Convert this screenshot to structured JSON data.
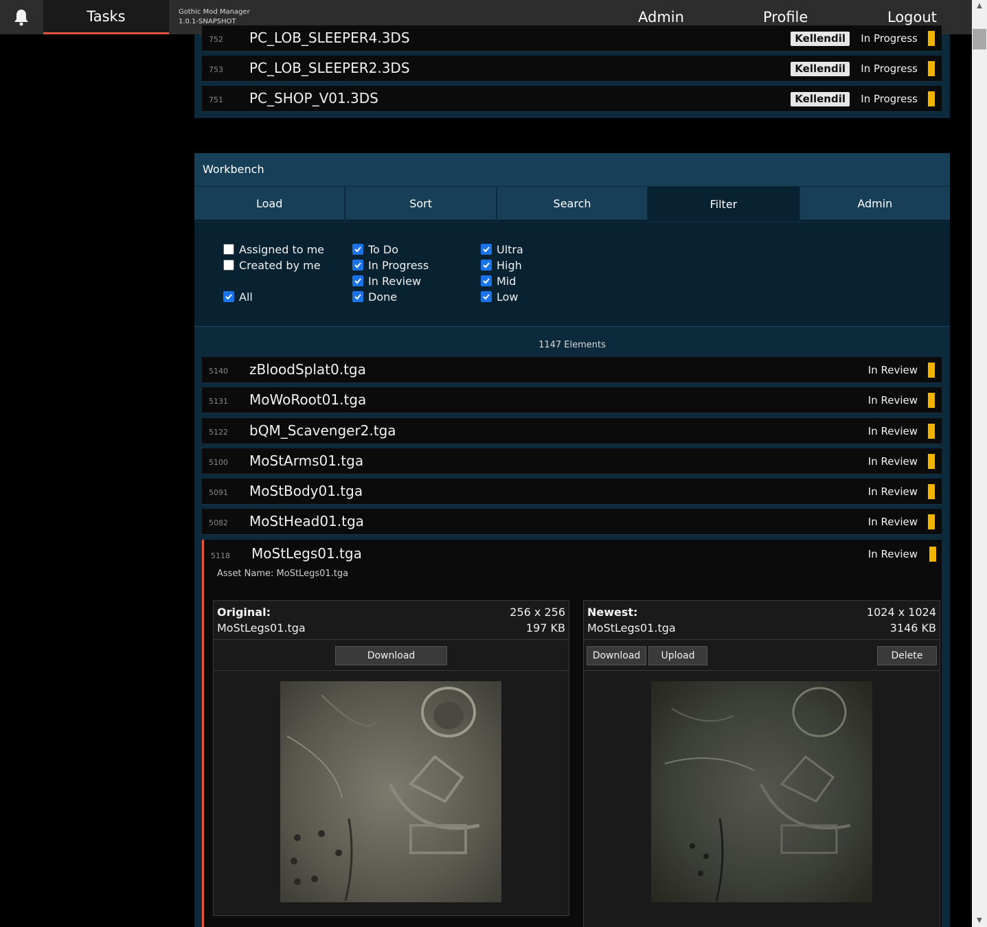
{
  "topbar": {
    "tasks": "Tasks",
    "app_name": "Gothic Mod Manager",
    "app_version": "1.0.1-SNAPSHOT",
    "admin": "Admin",
    "profile": "Profile",
    "logout": "Logout"
  },
  "top_rows": [
    {
      "id": "752",
      "name": "PC_LOB_SLEEPER4.3DS",
      "user": "Kellendil",
      "status": "In Progress"
    },
    {
      "id": "753",
      "name": "PC_LOB_SLEEPER2.3DS",
      "user": "Kellendil",
      "status": "In Progress"
    },
    {
      "id": "751",
      "name": "PC_SHOP_V01.3DS",
      "user": "Kellendil",
      "status": "In Progress"
    }
  ],
  "workbench": {
    "title": "Workbench",
    "tabs": [
      "Load",
      "Sort",
      "Search",
      "Filter",
      "Admin"
    ],
    "active_tab": "Filter",
    "filters": {
      "assigned_to_me": {
        "label": "Assigned to me",
        "checked": false
      },
      "created_by_me": {
        "label": "Created by me",
        "checked": false
      },
      "all": {
        "label": "All",
        "checked": true
      },
      "status": [
        {
          "label": "To Do",
          "checked": true
        },
        {
          "label": "In Progress",
          "checked": true
        },
        {
          "label": "In Review",
          "checked": true
        },
        {
          "label": "Done",
          "checked": true
        }
      ],
      "priority": [
        {
          "label": "Ultra",
          "checked": true
        },
        {
          "label": "High",
          "checked": true
        },
        {
          "label": "Mid",
          "checked": true
        },
        {
          "label": "Low",
          "checked": true
        }
      ]
    },
    "count": "1147 Elements"
  },
  "rows": [
    {
      "id": "5140",
      "name": "zBloodSplat0.tga",
      "status": "In Review"
    },
    {
      "id": "5131",
      "name": "MoWoRoot01.tga",
      "status": "In Review"
    },
    {
      "id": "5122",
      "name": "bQM_Scavenger2.tga",
      "status": "In Review"
    },
    {
      "id": "5100",
      "name": "MoStArms01.tga",
      "status": "In Review"
    },
    {
      "id": "5091",
      "name": "MoStBody01.tga",
      "status": "In Review"
    },
    {
      "id": "5082",
      "name": "MoStHead01.tga",
      "status": "In Review"
    }
  ],
  "expanded": {
    "id": "5118",
    "name": "MoStLegs01.tga",
    "status": "In Review",
    "asset_name": "Asset Name: MoStLegs01.tga",
    "original": {
      "label": "Original:",
      "file": "MoStLegs01.tga",
      "dims": "256 x 256",
      "size": "197 KB",
      "download": "Download"
    },
    "newest": {
      "label": "Newest:",
      "file": "MoStLegs01.tga",
      "dims": "1024 x 1024",
      "size": "3146 KB",
      "download": "Download",
      "upload": "Upload",
      "delete": "Delete"
    }
  },
  "colors": {
    "accent": "#e8553a",
    "status_bar": "#f0b400",
    "panel": "#0d2a3c",
    "header": "#173f58"
  },
  "icons": {
    "bell": "bell-icon",
    "check": "check-icon",
    "scroll_up": "chevron-up-icon",
    "scroll_down": "chevron-down-icon"
  }
}
